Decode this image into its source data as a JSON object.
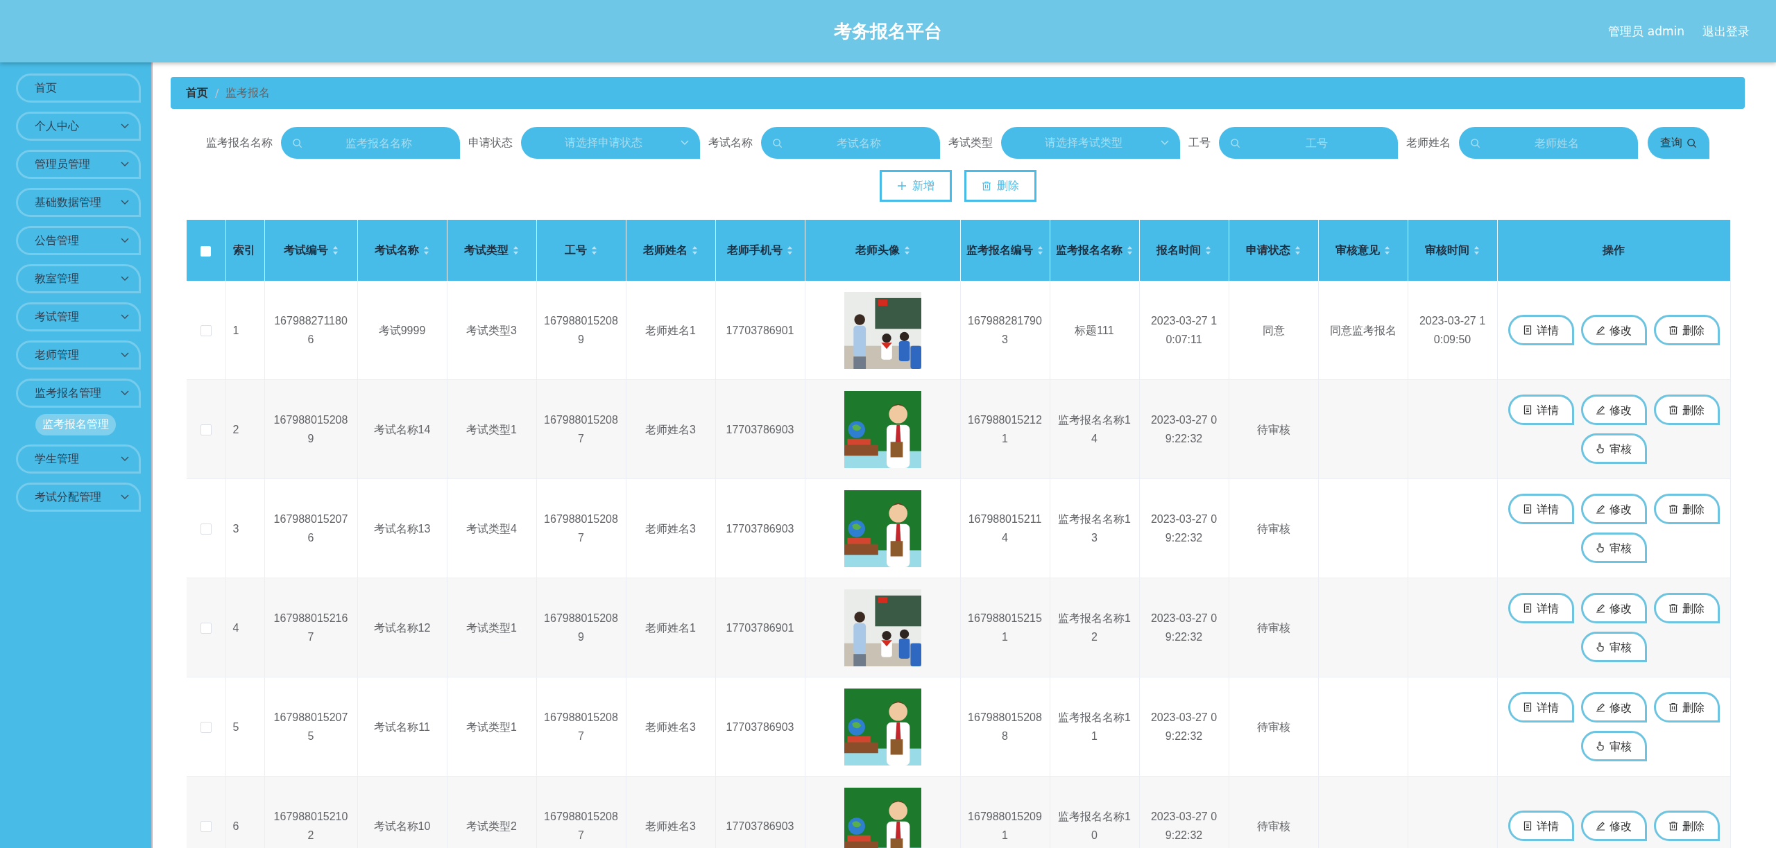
{
  "header": {
    "title": "考务报名平台",
    "user": "管理员 admin",
    "logout": "退出登录"
  },
  "sidebar": {
    "items": [
      {
        "label": "首页",
        "kind": "link"
      },
      {
        "label": "个人中心",
        "kind": "menu"
      },
      {
        "label": "管理员管理",
        "kind": "menu"
      },
      {
        "label": "基础数据管理",
        "kind": "menu"
      },
      {
        "label": "公告管理",
        "kind": "menu"
      },
      {
        "label": "教室管理",
        "kind": "menu"
      },
      {
        "label": "考试管理",
        "kind": "menu"
      },
      {
        "label": "老师管理",
        "kind": "menu"
      },
      {
        "label": "监考报名管理",
        "kind": "menu",
        "children": [
          {
            "label": "监考报名管理",
            "selected": true
          }
        ]
      },
      {
        "label": "学生管理",
        "kind": "menu"
      },
      {
        "label": "考试分配管理",
        "kind": "menu"
      }
    ]
  },
  "breadcrumb": {
    "separator": "/",
    "items": [
      "首页",
      "监考报名"
    ]
  },
  "filters": [
    {
      "label": "监考报名名称",
      "kind": "text",
      "placeholder": "监考报名名称"
    },
    {
      "label": "申请状态",
      "kind": "select",
      "placeholder": "请选择申请状态"
    },
    {
      "label": "考试名称",
      "kind": "text",
      "placeholder": "考试名称"
    },
    {
      "label": "考试类型",
      "kind": "select",
      "placeholder": "请选择考试类型"
    },
    {
      "label": "工号",
      "kind": "text",
      "placeholder": "工号"
    },
    {
      "label": "老师姓名",
      "kind": "text",
      "placeholder": "老师姓名"
    }
  ],
  "query_button": "查询",
  "toolbar": [
    {
      "label": "新增",
      "kind": "add"
    },
    {
      "label": "删除",
      "kind": "delete"
    }
  ],
  "table": {
    "select_all": {
      "checked": false
    },
    "columns": [
      {
        "label": "索引",
        "sortable": false
      },
      {
        "label": "考试编号",
        "sortable": true
      },
      {
        "label": "考试名称",
        "sortable": true
      },
      {
        "label": "考试类型",
        "sortable": true
      },
      {
        "label": "工号",
        "sortable": true
      },
      {
        "label": "老师姓名",
        "sortable": true
      },
      {
        "label": "老师手机号",
        "sortable": true
      },
      {
        "label": "老师头像",
        "sortable": true
      },
      {
        "label": "监考报名编号",
        "sortable": true
      },
      {
        "label": "监考报名名称",
        "sortable": true
      },
      {
        "label": "报名时间",
        "sortable": true
      },
      {
        "label": "申请状态",
        "sortable": true
      },
      {
        "label": "审核意见",
        "sortable": true
      },
      {
        "label": "审核时间",
        "sortable": true
      },
      {
        "label": "操作",
        "sortable": false
      }
    ],
    "rows": [
      {
        "checked": false,
        "index": "1",
        "exam_no": "1679882711806",
        "exam_name": "考试9999",
        "exam_type": "考试类型3",
        "staff_no": "1679880152089",
        "teacher_name": "老师姓名1",
        "teacher_phone": "17703786901",
        "avatar": {
          "kind": "picture"
        },
        "signup_no": "1679882817903",
        "signup_name": "标题111",
        "signup_time": "2023-03-27 10:07:11",
        "status": "同意",
        "review_comment": "同意监考报名",
        "review_time": "2023-03-27 10:09:50",
        "actions": [
          {
            "label": "详情",
            "kind": "detail"
          },
          {
            "label": "修改",
            "kind": "edit"
          },
          {
            "label": "删除",
            "kind": "delete"
          }
        ]
      },
      {
        "checked": false,
        "index": "2",
        "exam_no": "1679880152089",
        "exam_name": "考试名称14",
        "exam_type": "考试类型1",
        "staff_no": "1679880152087",
        "teacher_name": "老师姓名3",
        "teacher_phone": "17703786903",
        "avatar": {
          "kind": "picture"
        },
        "signup_no": "1679880152121",
        "signup_name": "监考报名名称14",
        "signup_time": "2023-03-27 09:22:32",
        "status": "待审核",
        "actions": [
          {
            "label": "详情",
            "kind": "detail"
          },
          {
            "label": "修改",
            "kind": "edit"
          },
          {
            "label": "删除",
            "kind": "delete"
          },
          {
            "label": "审核",
            "kind": "review"
          }
        ]
      },
      {
        "checked": false,
        "index": "3",
        "exam_no": "1679880152076",
        "exam_name": "考试名称13",
        "exam_type": "考试类型4",
        "staff_no": "1679880152087",
        "teacher_name": "老师姓名3",
        "teacher_phone": "17703786903",
        "avatar": {
          "kind": "picture"
        },
        "signup_no": "1679880152114",
        "signup_name": "监考报名名称13",
        "signup_time": "2023-03-27 09:22:32",
        "status": "待审核",
        "actions": [
          {
            "label": "详情",
            "kind": "detail"
          },
          {
            "label": "修改",
            "kind": "edit"
          },
          {
            "label": "删除",
            "kind": "delete"
          },
          {
            "label": "审核",
            "kind": "review"
          }
        ]
      },
      {
        "checked": false,
        "index": "4",
        "exam_no": "1679880152167",
        "exam_name": "考试名称12",
        "exam_type": "考试类型1",
        "staff_no": "1679880152089",
        "teacher_name": "老师姓名1",
        "teacher_phone": "17703786901",
        "avatar": {
          "kind": "picture"
        },
        "signup_no": "1679880152151",
        "signup_name": "监考报名名称12",
        "signup_time": "2023-03-27 09:22:32",
        "status": "待审核",
        "actions": [
          {
            "label": "详情",
            "kind": "detail"
          },
          {
            "label": "修改",
            "kind": "edit"
          },
          {
            "label": "删除",
            "kind": "delete"
          },
          {
            "label": "审核",
            "kind": "review"
          }
        ]
      },
      {
        "checked": false,
        "index": "5",
        "exam_no": "1679880152075",
        "exam_name": "考试名称11",
        "exam_type": "考试类型1",
        "staff_no": "1679880152087",
        "teacher_name": "老师姓名3",
        "teacher_phone": "17703786903",
        "avatar": {
          "kind": "picture"
        },
        "signup_no": "1679880152088",
        "signup_name": "监考报名名称11",
        "signup_time": "2023-03-27 09:22:32",
        "status": "待审核",
        "actions": [
          {
            "label": "详情",
            "kind": "detail"
          },
          {
            "label": "修改",
            "kind": "edit"
          },
          {
            "label": "删除",
            "kind": "delete"
          },
          {
            "label": "审核",
            "kind": "review"
          }
        ]
      },
      {
        "checked": false,
        "index": "6",
        "exam_no": "1679880152102",
        "exam_name": "考试名称10",
        "exam_type": "考试类型2",
        "staff_no": "1679880152087",
        "teacher_name": "老师姓名3",
        "teacher_phone": "17703786903",
        "avatar": {
          "kind": "picture"
        },
        "signup_no": "1679880152091",
        "signup_name": "监考报名名称10",
        "signup_time": "2023-03-27 09:22:32",
        "status": "待审核",
        "actions": [
          {
            "label": "详情",
            "kind": "detail"
          },
          {
            "label": "修改",
            "kind": "edit"
          },
          {
            "label": "删除",
            "kind": "delete"
          }
        ]
      }
    ]
  }
}
